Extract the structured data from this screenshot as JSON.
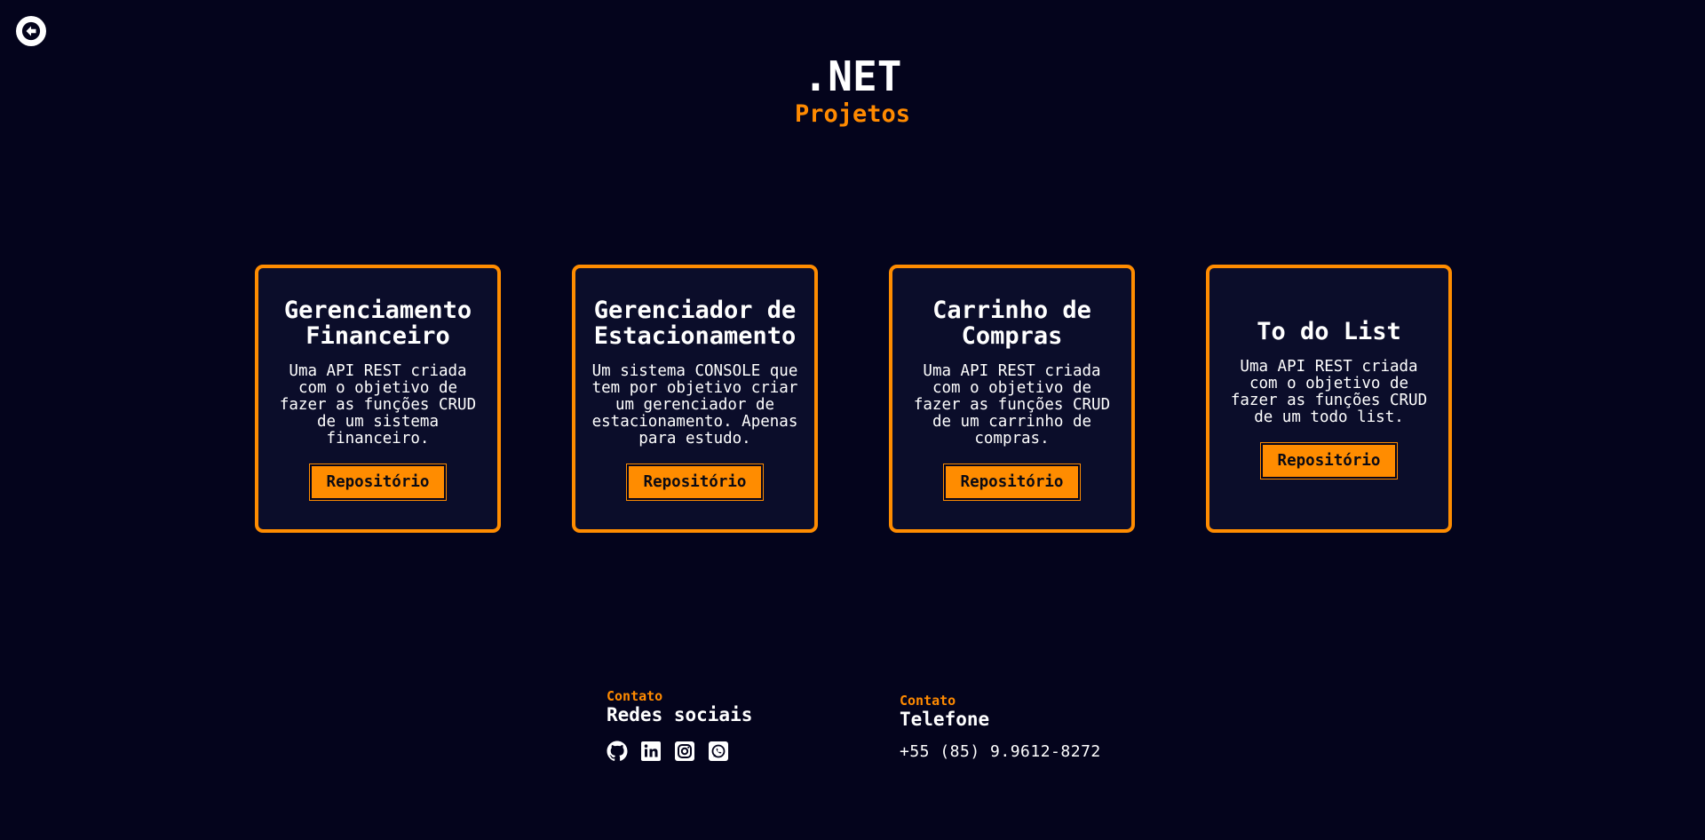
{
  "header": {
    "title": ".NET",
    "subtitle": "Projetos"
  },
  "colors": {
    "background": "#04041c",
    "accent": "#ff8c00",
    "card_background": "#0b0d2a"
  },
  "nav": {
    "back_icon": "arrow-left-icon"
  },
  "projects": [
    {
      "title": "Gerenciamento Financeiro",
      "description": "Uma API REST criada com o objetivo de fazer as funções CRUD de um sistema financeiro.",
      "button": "Repositório"
    },
    {
      "title": "Gerenciador de Estacionamento",
      "description": "Um sistema CONSOLE que tem por objetivo criar um gerenciador de estacionamento. Apenas para estudo.",
      "button": "Repositório"
    },
    {
      "title": "Carrinho de Compras",
      "description": "Uma API REST criada com o objetivo de fazer as funções CRUD de um carrinho de compras.",
      "button": "Repositório"
    },
    {
      "title": "To do List",
      "description": "Uma API REST criada com o objetivo de fazer as funções CRUD de um todo list.",
      "button": "Repositório"
    }
  ],
  "footer": {
    "social": {
      "label": "Contato",
      "heading": "Redes sociais",
      "icons": [
        "github-icon",
        "linkedin-icon",
        "instagram-icon",
        "whatsapp-icon"
      ]
    },
    "phone": {
      "label": "Contato",
      "heading": "Telefone",
      "number": "+55 (85) 9.9612-8272"
    }
  }
}
